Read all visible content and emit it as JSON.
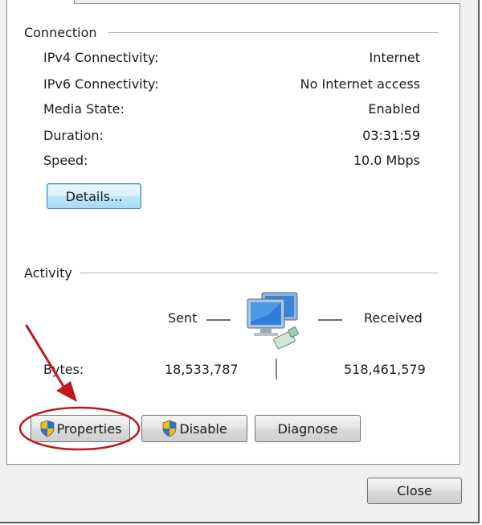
{
  "connection": {
    "title": "Connection",
    "rows": [
      {
        "label": "IPv4 Connectivity:",
        "value": "Internet"
      },
      {
        "label": "IPv6 Connectivity:",
        "value": "No Internet access"
      },
      {
        "label": "Media State:",
        "value": "Enabled"
      },
      {
        "label": "Duration:",
        "value": "03:31:59"
      },
      {
        "label": "Speed:",
        "value": "10.0 Mbps"
      }
    ],
    "details_button": "Details..."
  },
  "activity": {
    "title": "Activity",
    "sent_label": "Sent",
    "received_label": "Received",
    "bytes_label": "Bytes:",
    "bytes_sent": "18,533,787",
    "bytes_received": "518,461,579"
  },
  "buttons": {
    "properties": "Properties",
    "disable": "Disable",
    "diagnose": "Diagnose",
    "close": "Close"
  },
  "icons": {
    "network": "network-computers-icon",
    "shield": "uac-shield-icon",
    "annotation_arrow": "red-arrow-annotation",
    "annotation_ellipse": "red-ellipse-annotation"
  },
  "colors": {
    "annotation": "#c0171c",
    "focus_border": "#3c7fb1",
    "window_bg": "#f0f0f0"
  }
}
